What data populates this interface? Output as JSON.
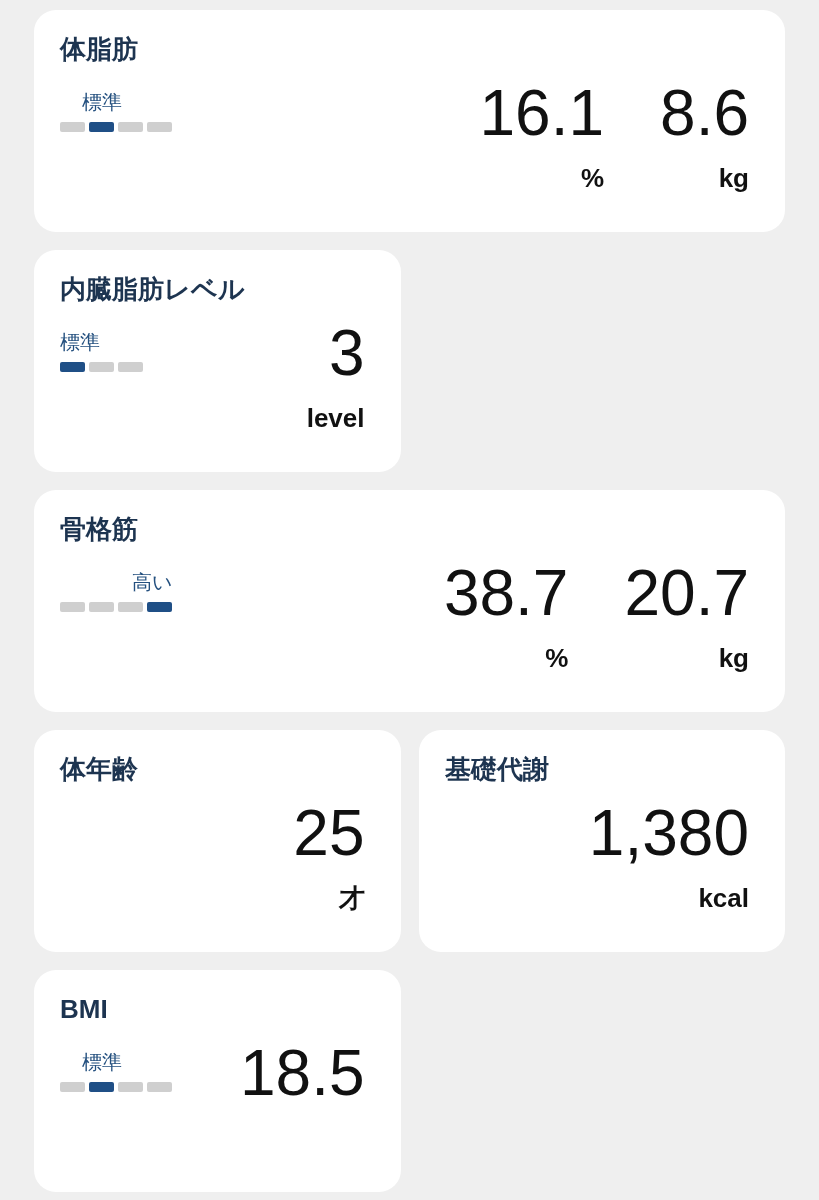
{
  "cards": [
    {
      "kind": "wide",
      "title": "体脂肪",
      "rating": {
        "label": "標準",
        "segments": [
          {
            "selected": false
          },
          {
            "selected": true
          },
          {
            "selected": false
          },
          {
            "selected": false
          }
        ]
      },
      "values": [
        {
          "number": "16.1",
          "unit": "%"
        },
        {
          "number": "8.6",
          "unit": "kg"
        }
      ]
    },
    {
      "kind": "compact",
      "title": "内臓脂肪レベル",
      "rating": {
        "label": "標準",
        "segments": [
          {
            "selected": true
          },
          {
            "selected": false
          },
          {
            "selected": false
          }
        ]
      },
      "values": [
        {
          "number": "3",
          "unit": "level"
        }
      ]
    },
    {
      "kind": "wide",
      "title": "骨格筋",
      "rating": {
        "label": "高い",
        "segments": [
          {
            "selected": false
          },
          {
            "selected": false
          },
          {
            "selected": false
          },
          {
            "selected": true
          }
        ]
      },
      "values": [
        {
          "number": "38.7",
          "unit": "%"
        },
        {
          "number": "20.7",
          "unit": "kg"
        }
      ]
    },
    {
      "kind": "compact",
      "title": "体年齢",
      "values": [
        {
          "number": "25",
          "unit": "才"
        }
      ]
    },
    {
      "kind": "compact",
      "title": "基礎代謝",
      "values": [
        {
          "number": "1,380",
          "unit": "kcal"
        }
      ]
    },
    {
      "kind": "compact",
      "title": "BMI",
      "rating": {
        "label": "標準",
        "segments": [
          {
            "selected": false
          },
          {
            "selected": true
          },
          {
            "selected": false
          },
          {
            "selected": false
          }
        ]
      },
      "values": [
        {
          "number": "18.5"
        }
      ]
    }
  ]
}
